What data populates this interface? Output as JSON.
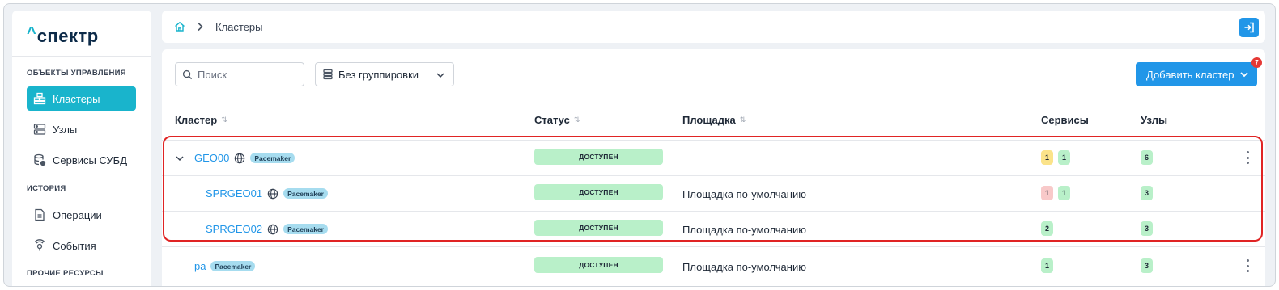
{
  "brand": {
    "caret": "^",
    "word": "спектр"
  },
  "sidebar": {
    "sections": [
      "ОБЪЕКТЫ УПРАВЛЕНИЯ",
      "ИСТОРИЯ",
      "ПРОЧИЕ РЕСУРСЫ"
    ],
    "items": [
      {
        "label": "Кластеры",
        "icon": "clusters-icon",
        "active": true
      },
      {
        "label": "Узлы",
        "icon": "nodes-icon"
      },
      {
        "label": "Сервисы СУБД",
        "icon": "database-services-icon"
      },
      {
        "label": "Операции",
        "icon": "operations-icon"
      },
      {
        "label": "События",
        "icon": "events-icon"
      }
    ]
  },
  "header": {
    "breadcrumb_current": "Кластеры",
    "icons": [
      "home-icon",
      "chevron-right-icon",
      "logout-icon"
    ]
  },
  "toolbar": {
    "search_placeholder": "Поиск",
    "grouping_label": "Без группировки",
    "add_button_label": "Добавить кластер",
    "add_badge_count": "7"
  },
  "table": {
    "columns": [
      "Кластер",
      "Статус",
      "Площадка",
      "Сервисы",
      "Узлы"
    ],
    "rows": [
      {
        "name": "GEO00",
        "expandable": true,
        "tag": "Pacemaker",
        "status": "ДОСТУПЕН",
        "site": "",
        "services": [
          {
            "v": "1",
            "c": "yellow"
          },
          {
            "v": "1",
            "c": "green"
          }
        ],
        "nodes": "6"
      },
      {
        "name": "SPRGEO01",
        "tag": "Pacemaker",
        "status": "ДОСТУПЕН",
        "site": "Площадка по-умолчанию",
        "services": [
          {
            "v": "1",
            "c": "red"
          },
          {
            "v": "1",
            "c": "green"
          }
        ],
        "nodes": "3"
      },
      {
        "name": "SPRGEO02",
        "tag": "Pacemaker",
        "status": "ДОСТУПЕН",
        "site": "Площадка по-умолчанию",
        "services": [
          {
            "v": "2",
            "c": "green"
          }
        ],
        "nodes": "3"
      },
      {
        "name": "pa",
        "tag": "Pacemaker",
        "status": "ДОСТУПЕН",
        "site": "Площадка по-умолчанию",
        "services": [
          {
            "v": "1",
            "c": "green"
          }
        ],
        "nodes": "3"
      }
    ]
  },
  "colors": {
    "accent": "#19b4cc",
    "primary": "#2196e8",
    "status_ok": "#b9f0c9",
    "highlight": "#e02424"
  }
}
